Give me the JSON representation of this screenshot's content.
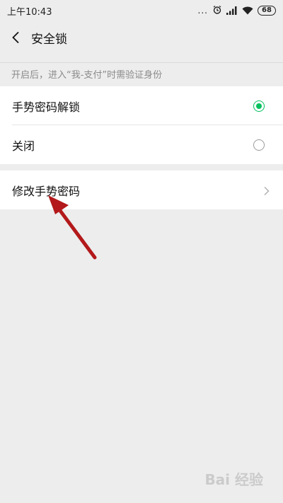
{
  "status_bar": {
    "time": "上午10:43",
    "dots": "...",
    "battery": "68",
    "icons": [
      "alarm-icon",
      "signal-icon",
      "wifi-icon",
      "battery-icon"
    ]
  },
  "header": {
    "title": "安全锁",
    "back_icon": "back-chevron-icon"
  },
  "hint": "开启后，进入“我-支付”时需验证身份",
  "options": [
    {
      "label": "手势密码解锁",
      "selected": true
    },
    {
      "label": "关闭",
      "selected": false
    }
  ],
  "action": {
    "label": "修改手势密码",
    "icon": "chevron-right-icon"
  },
  "colors": {
    "accent": "#07c160",
    "background": "#ededed",
    "annotation_arrow": "#b3191b"
  },
  "watermark": "Bai 经验"
}
